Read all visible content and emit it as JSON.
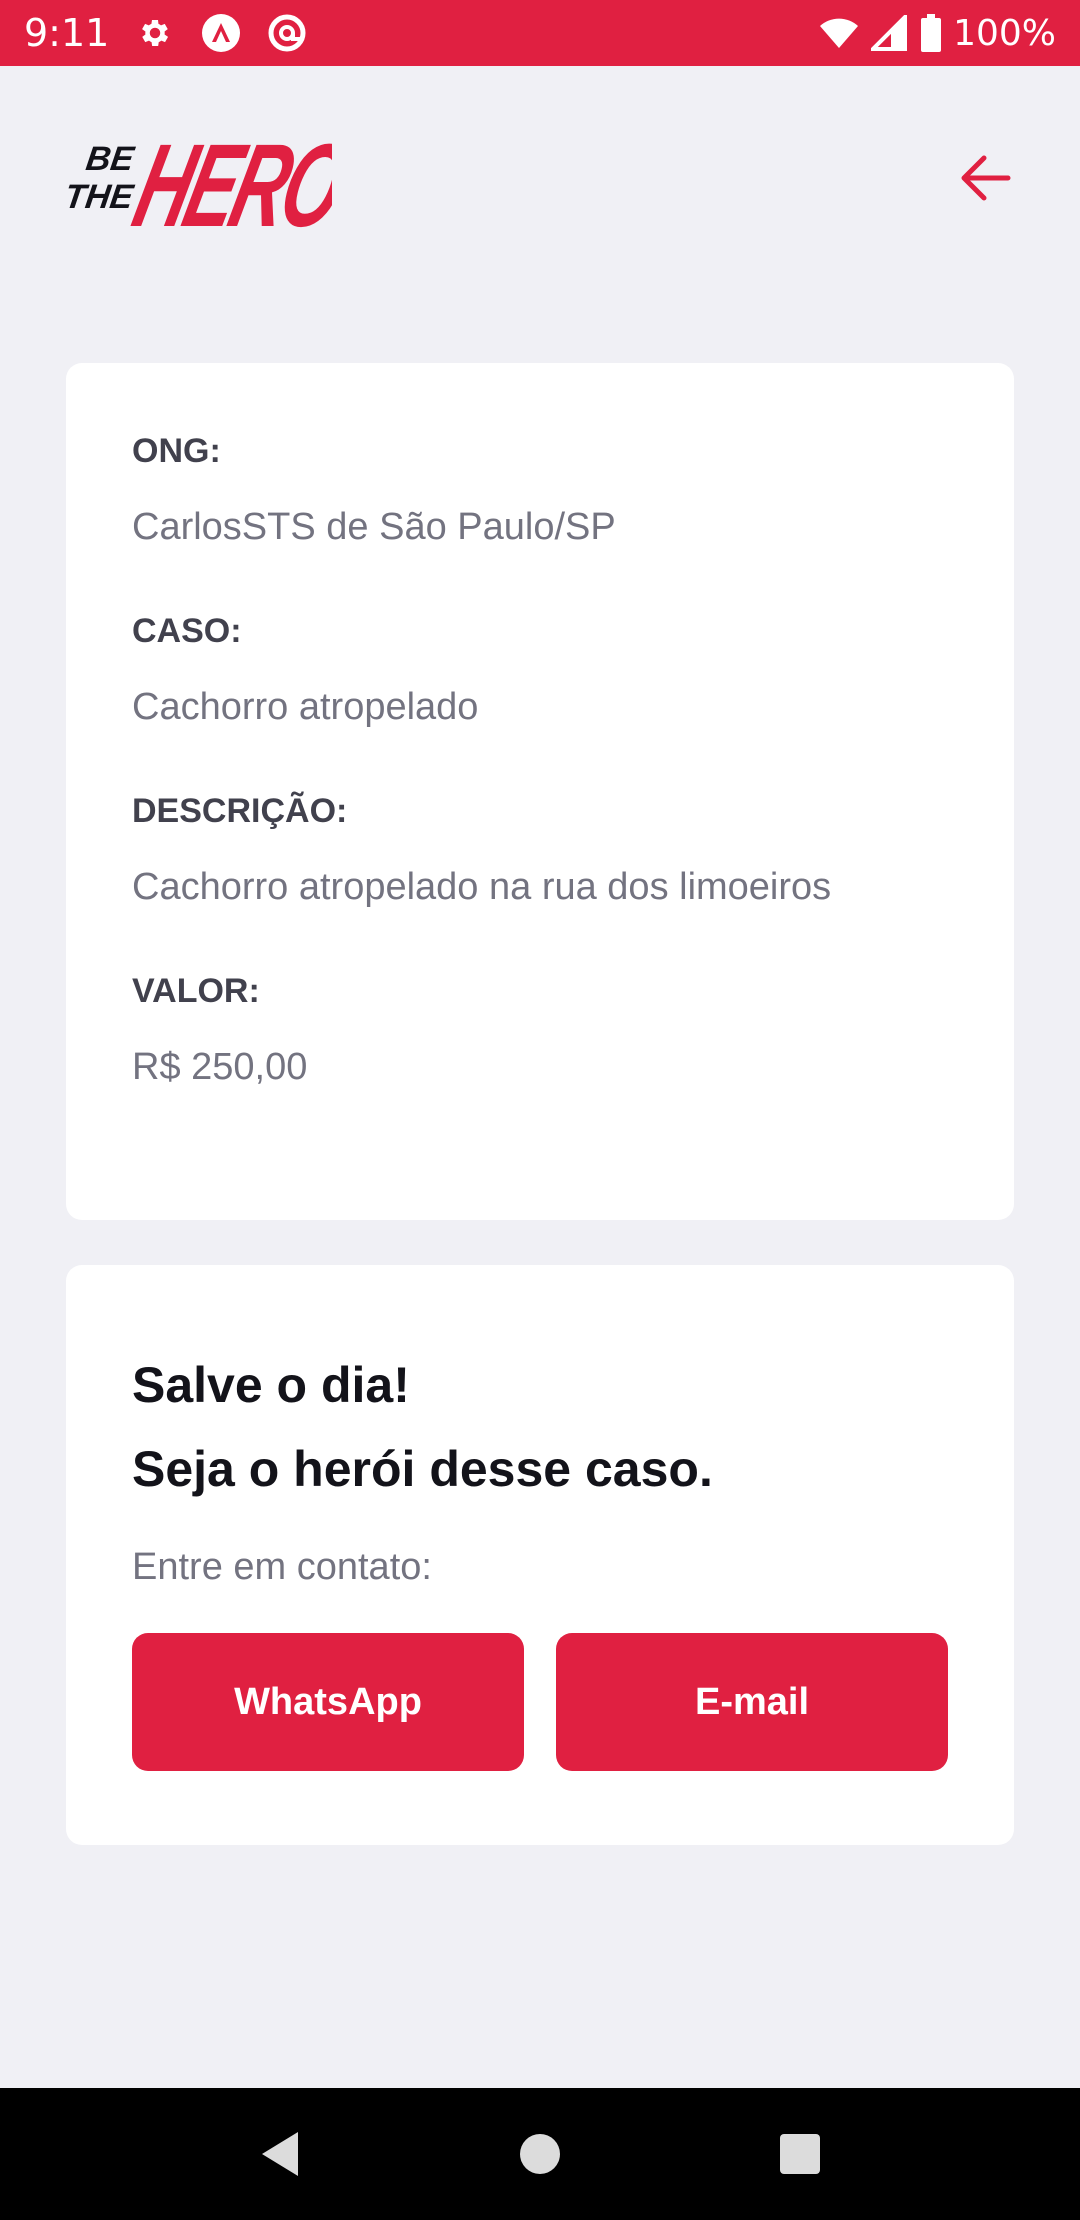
{
  "status_bar": {
    "time": "9:11",
    "battery_percent": "100%",
    "icons": [
      "settings-icon",
      "app-icon",
      "at-icon",
      "wifi-icon",
      "signal-icon",
      "battery-icon"
    ]
  },
  "header": {
    "logo_text": "BE THE HERO",
    "back_icon": "arrow-left-icon"
  },
  "incident": {
    "ong_label": "ONG:",
    "ong_value": "CarlosSTS de São Paulo/SP",
    "case_label": "CASO:",
    "case_value": "Cachorro atropelado",
    "description_label": "DESCRIÇÃO:",
    "description_value": "Cachorro atropelado na rua dos limoeiros",
    "value_label": "VALOR:",
    "value_value": "R$ 250,00"
  },
  "contact": {
    "title_line1": "Salve o dia!",
    "title_line2": "Seja o herói desse caso.",
    "subtitle": "Entre em contato:",
    "whatsapp_label": "WhatsApp",
    "email_label": "E-mail"
  },
  "nav_bar": {
    "icons": [
      "back-triangle-icon",
      "home-circle-icon",
      "recents-square-icon"
    ]
  },
  "colors": {
    "accent": "#e02041",
    "background": "#f0f0f5",
    "card": "#ffffff",
    "label": "#41414d",
    "value": "#737380",
    "title": "#13131a"
  }
}
